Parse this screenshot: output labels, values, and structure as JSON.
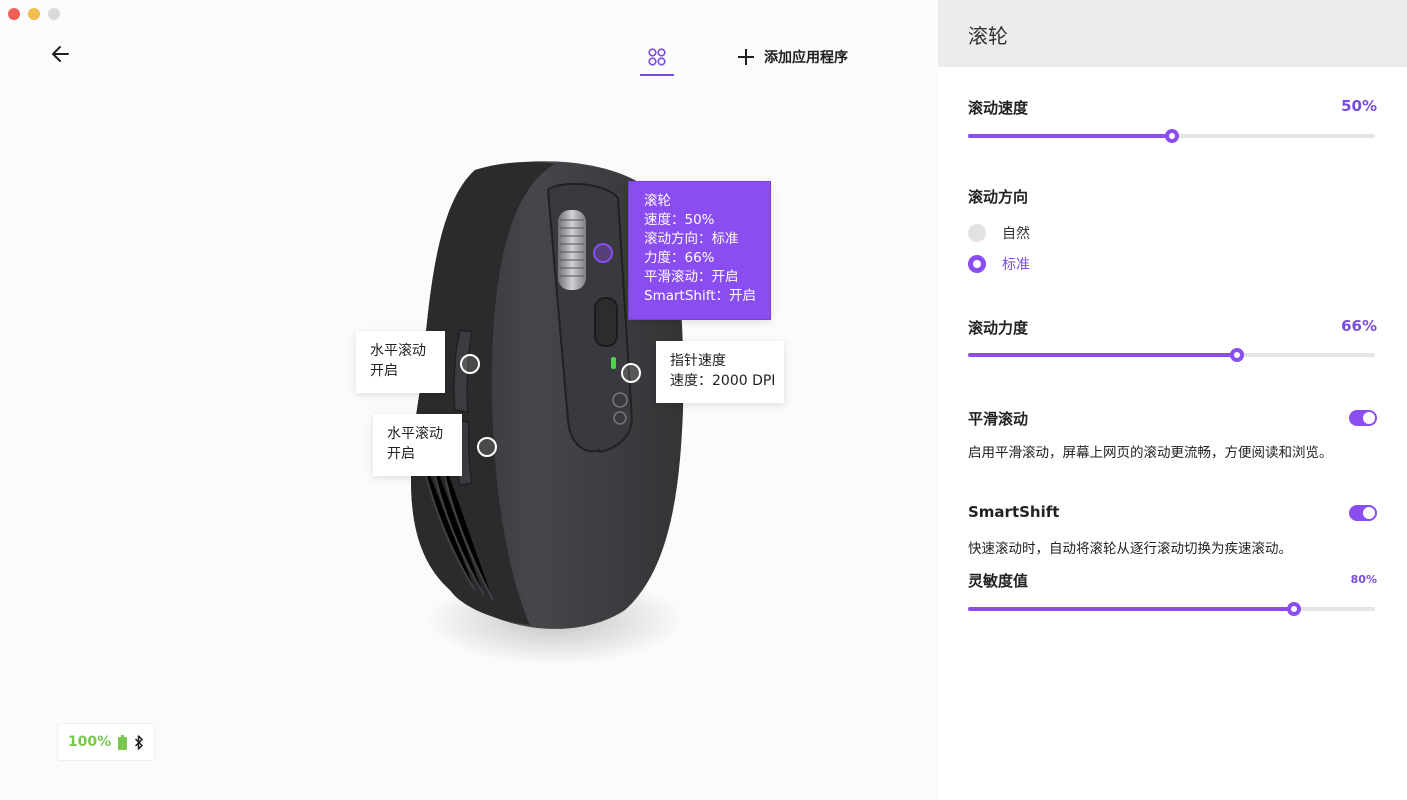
{
  "toolbar": {
    "add_app_label": "添加应用程序"
  },
  "callouts": {
    "scroll_wheel": {
      "lines": [
        "滚轮",
        "速度：50%",
        "滚动方向：标准",
        "力度：66%",
        "平滑滚动：开启",
        "SmartShift：开启"
      ]
    },
    "pointer_speed": {
      "lines": [
        "指针速度",
        "速度：2000 DPI"
      ]
    },
    "hscroll_1": {
      "lines": [
        "水平滚动",
        "开启"
      ]
    },
    "hscroll_2": {
      "lines": [
        "水平滚动",
        "开启"
      ]
    }
  },
  "battery": {
    "percent": "100%"
  },
  "panel": {
    "title": "滚轮",
    "scroll_speed": {
      "label": "滚动速度",
      "value_text": "50%",
      "value": 0.5
    },
    "scroll_direction": {
      "label": "滚动方向",
      "options": [
        {
          "label": "自然",
          "selected": false
        },
        {
          "label": "标准",
          "selected": true
        }
      ]
    },
    "scroll_force": {
      "label": "滚动力度",
      "value_text": "66%",
      "value": 0.66
    },
    "smooth_scroll": {
      "label": "平滑滚动",
      "enabled": true,
      "description": "启用平滑滚动，屏幕上网页的滚动更流畅，方便阅读和浏览。"
    },
    "smartshift": {
      "label": "SmartShift",
      "enabled": true,
      "description": "快速滚动时，自动将滚轮从逐行滚动切换为疾速滚动。"
    },
    "sensitivity": {
      "label": "灵敏度值",
      "value_text": "80%",
      "value": 0.8
    }
  },
  "colors": {
    "accent": "#8a4df0",
    "battery_green": "#7ac74f"
  },
  "icons": {
    "back": "arrow-left-icon",
    "grid": "grid-icon",
    "add": "plus-icon",
    "battery": "battery-icon",
    "bluetooth": "bluetooth-icon"
  }
}
